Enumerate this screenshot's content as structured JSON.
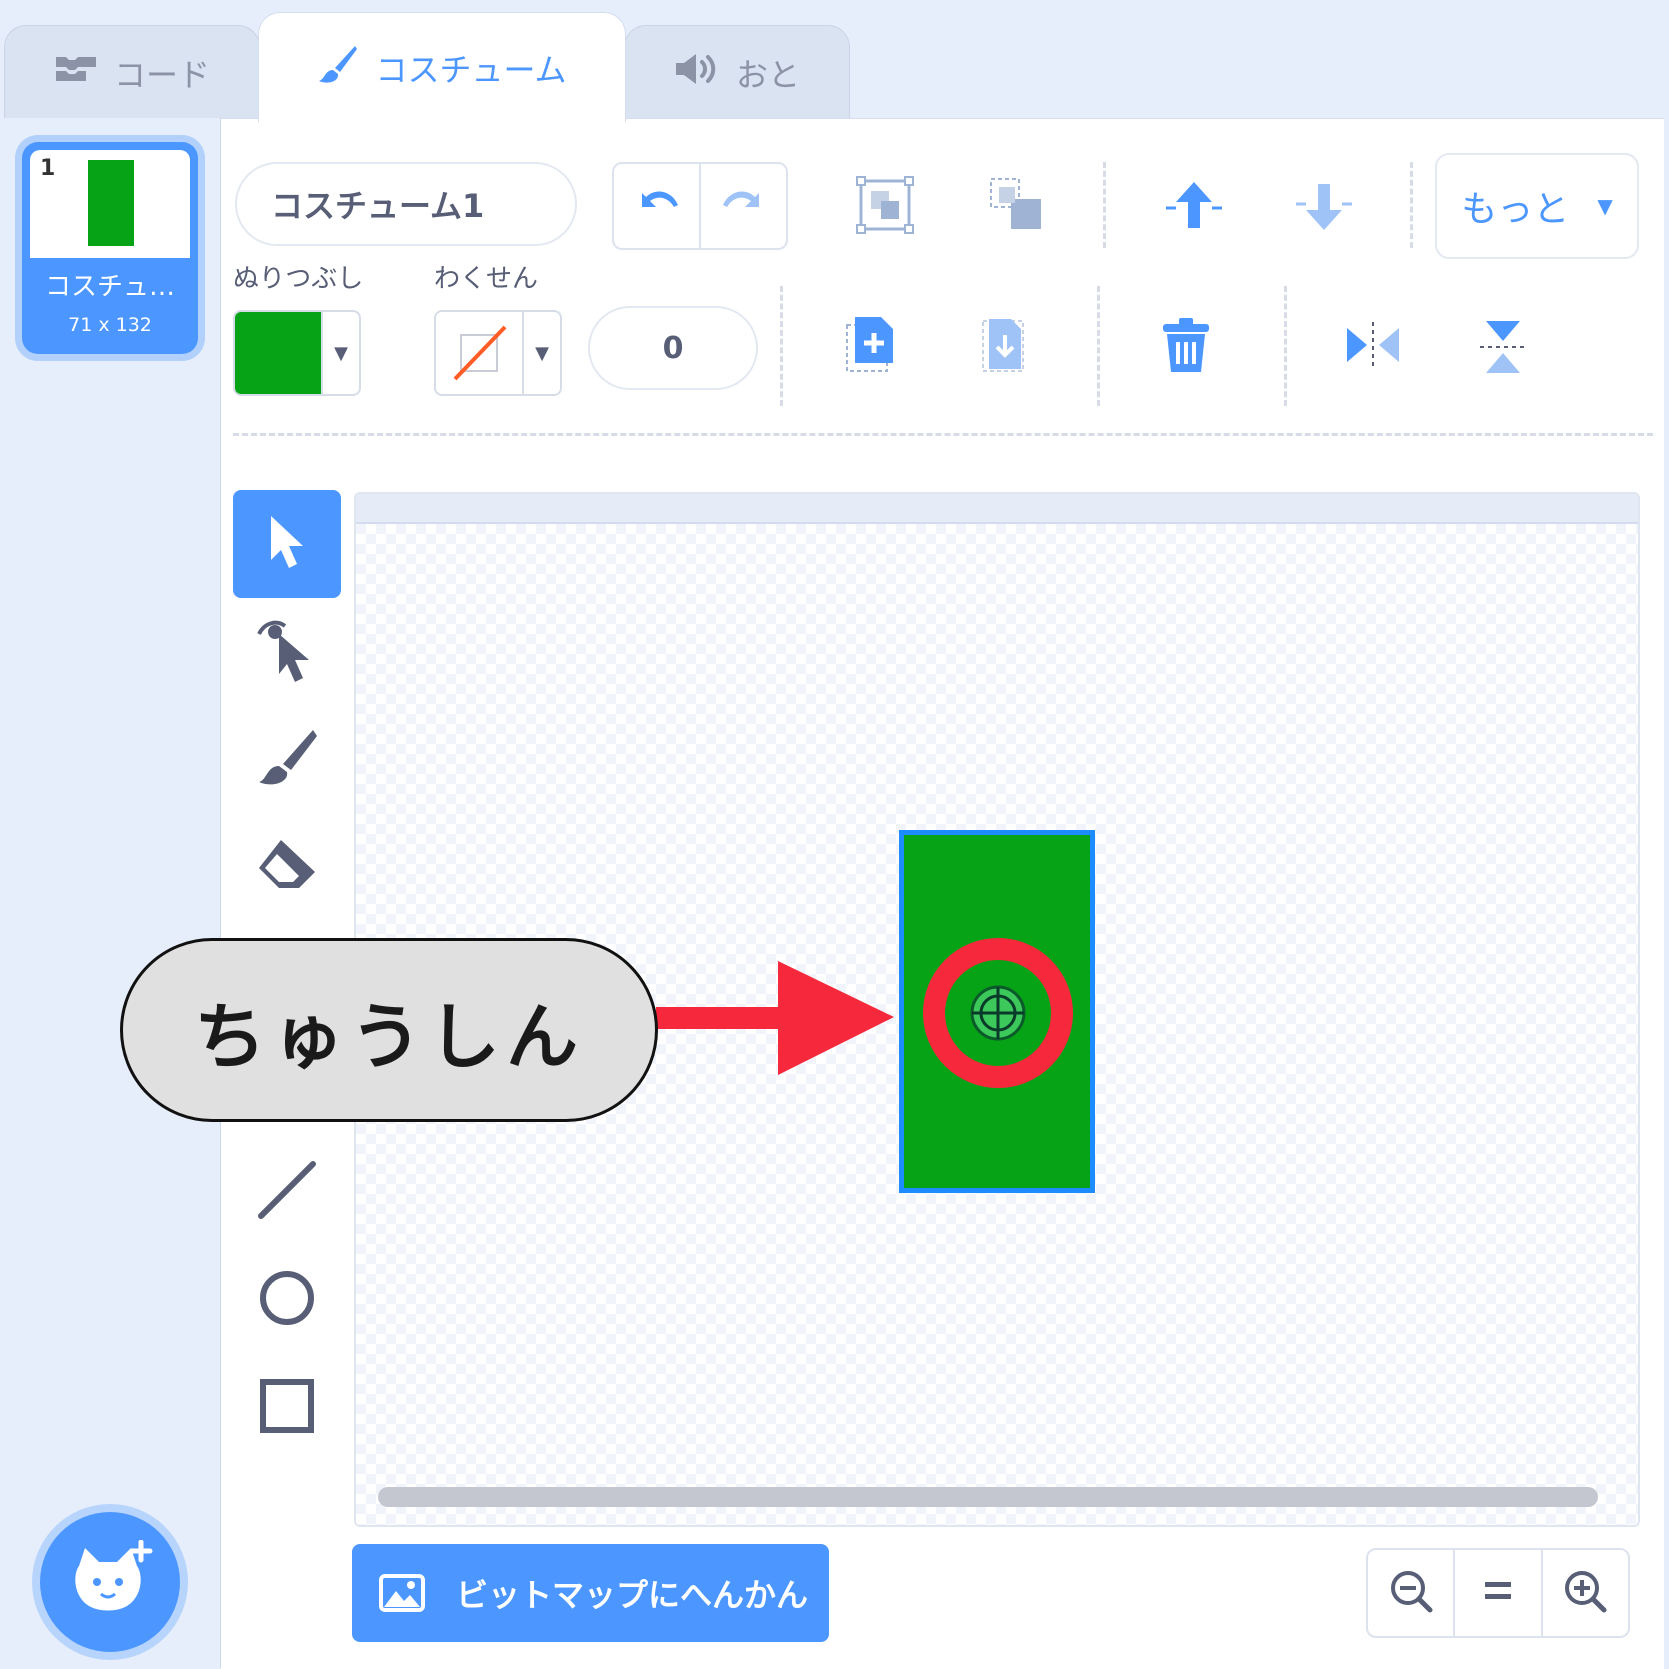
{
  "tabs": [
    {
      "label": "コード",
      "icon": "code-blocks-icon"
    },
    {
      "label": "コスチューム",
      "icon": "paintbrush-icon"
    },
    {
      "label": "おと",
      "icon": "speaker-icon"
    }
  ],
  "costume_list": {
    "items": [
      {
        "number": "1",
        "name": "コスチュ…",
        "size": "71 x 132"
      }
    ],
    "add_button_icon": "cat-add-icon"
  },
  "editor": {
    "costume_name": "コスチューム1",
    "fill_label": "ぬりつぶし",
    "outline_label": "わくせん",
    "fill_color": "#07a316",
    "outline_value": "0",
    "more_label": "もっと"
  },
  "tools": [
    {
      "name": "select",
      "icon": "arrow-pointer-icon",
      "active": true
    },
    {
      "name": "reshape",
      "icon": "reshape-icon"
    },
    {
      "name": "brush",
      "icon": "brush-icon"
    },
    {
      "name": "eraser",
      "icon": "eraser-icon"
    },
    {
      "name": "line",
      "icon": "line-icon"
    },
    {
      "name": "circle",
      "icon": "circle-icon"
    },
    {
      "name": "rectangle",
      "icon": "rectangle-icon"
    }
  ],
  "callout": {
    "text": "ちゅうしん"
  },
  "bottom": {
    "convert_label": "ビットマップにへんかん"
  },
  "colors": {
    "accent": "#4c97ff",
    "shape_fill": "#07a316",
    "selection": "#1d8cff",
    "annotation": "#f5283c"
  }
}
